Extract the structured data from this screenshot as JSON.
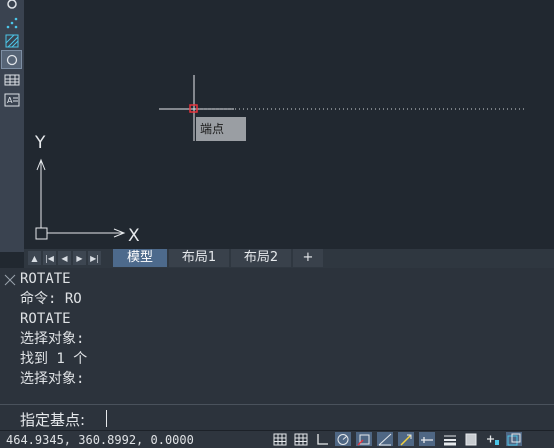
{
  "canvas": {
    "osnap_tooltip": "端点",
    "ucs_y_label": "Y",
    "ucs_x_label": "X"
  },
  "layout_tabs": {
    "nav": [
      "▲",
      "|◀",
      "◀",
      "▶",
      "▶|"
    ],
    "tabs": [
      "模型",
      "布局1",
      "布局2"
    ],
    "active": "模型",
    "add_label": "+"
  },
  "command": {
    "history": [
      "ROTATE",
      "命令: RO",
      "ROTATE",
      "选择对象:",
      "找到 1 个",
      "选择对象:"
    ],
    "prompt": "指定基点:"
  },
  "status": {
    "coordinates": "464.9345, 360.8992, 0.0000"
  },
  "colors": {
    "canvas_bg": "#212830",
    "panel_bg": "#2c333c",
    "accent": "#4d6a8c",
    "osnap_marker": "#e8323c",
    "ucs": "#e6e9ec"
  }
}
